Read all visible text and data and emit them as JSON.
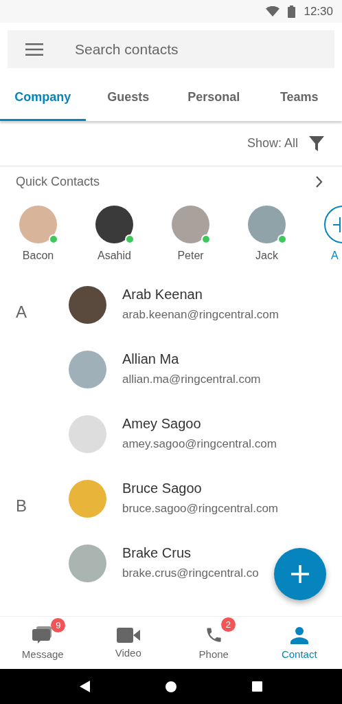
{
  "status_bar": {
    "time": "12:30"
  },
  "search": {
    "placeholder": "Search contacts"
  },
  "tabs": [
    {
      "label": "Company",
      "selected": true
    },
    {
      "label": "Guests",
      "selected": false
    },
    {
      "label": "Personal",
      "selected": false
    },
    {
      "label": "Teams",
      "selected": false
    }
  ],
  "filter": {
    "label": "Show: All"
  },
  "quick_contacts": {
    "title": "Quick Contacts",
    "items": [
      {
        "name": "Bacon",
        "online": true
      },
      {
        "name": "Asahid",
        "online": true
      },
      {
        "name": "Peter",
        "online": true
      },
      {
        "name": "Jack",
        "online": true
      }
    ],
    "add_label": "A"
  },
  "sections": [
    {
      "letter": "A",
      "contacts": [
        {
          "name": "Arab Keenan",
          "email": "arab.keenan@ringcentral.com"
        },
        {
          "name": "Allian Ma",
          "email": "allian.ma@ringcentral.com"
        },
        {
          "name": "Amey Sagoo",
          "email": "amey.sagoo@ringcentral.com"
        }
      ]
    },
    {
      "letter": "B",
      "contacts": [
        {
          "name": "Bruce Sagoo",
          "email": "bruce.sagoo@ringcentral.com"
        },
        {
          "name": "Brake Crus",
          "email": "brake.crus@ringcentral.co"
        }
      ]
    }
  ],
  "bottom_nav": [
    {
      "kind": "message",
      "label": "Message",
      "badge": "9",
      "selected": false
    },
    {
      "kind": "video",
      "label": "Video",
      "selected": false
    },
    {
      "kind": "phone",
      "label": "Phone",
      "badge": "2",
      "selected": false
    },
    {
      "kind": "contact",
      "label": "Contact",
      "selected": true
    }
  ]
}
